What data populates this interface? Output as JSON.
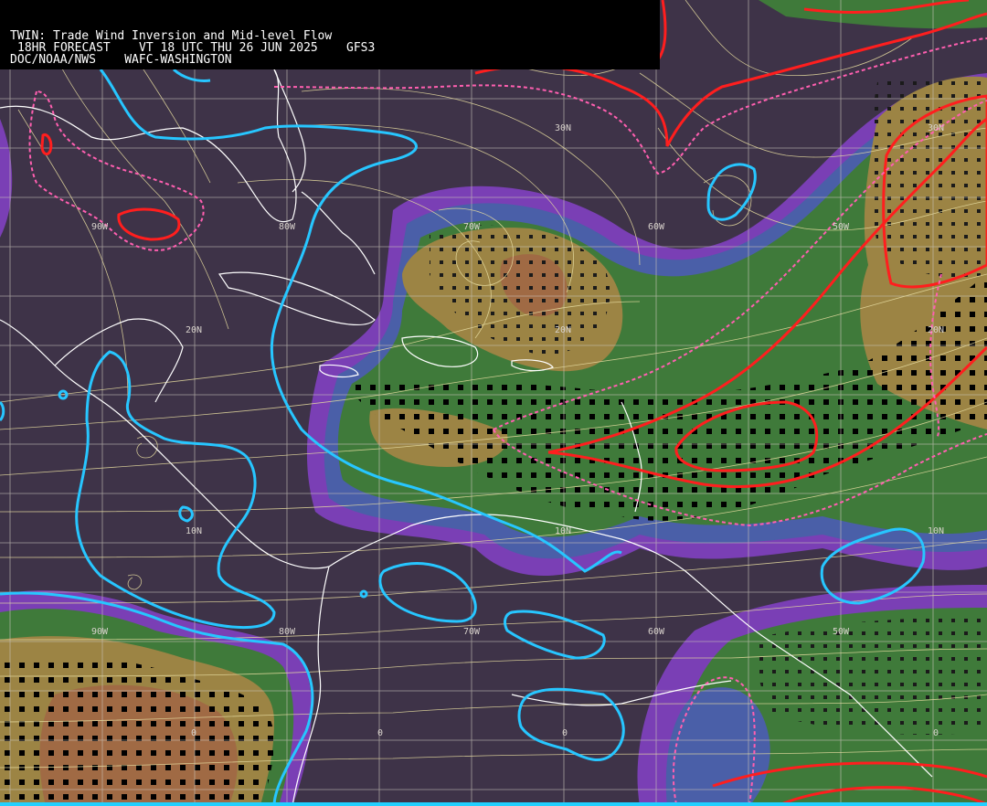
{
  "header": {
    "line1": "TWIN: Trade Wind Inversion and Mid-level Flow",
    "line2": "18HR FORECAST    VT 18 UTC THU 26 JUN 2025    GFS3",
    "line3": "DOC/NOAA/NWS    WAFC-WASHINGTON"
  },
  "grid_labels": {
    "lat": [
      "30N",
      "30N",
      "20N",
      "20N",
      "20N",
      "10N",
      "10N",
      "10N",
      "0",
      "0",
      "0",
      "0"
    ],
    "lon": [
      "90W",
      "80W",
      "70W",
      "60W",
      "50W",
      "90W",
      "80W",
      "70W",
      "60W",
      "50W"
    ]
  },
  "colors": {
    "background": "#3e3348",
    "purple_band": "#7a3fb5",
    "blue_band": "#4a5fa8",
    "green": "#3f7a3a",
    "tan": "#9c8444",
    "brown": "#a06a44",
    "cyan_contour": "#27c6ff",
    "red_contour": "#ff1e1e",
    "pink_dashed": "#ff5fb0",
    "streamline": "#e6dca0",
    "coast": "#ffffff",
    "grid": "#c8c2b8"
  }
}
